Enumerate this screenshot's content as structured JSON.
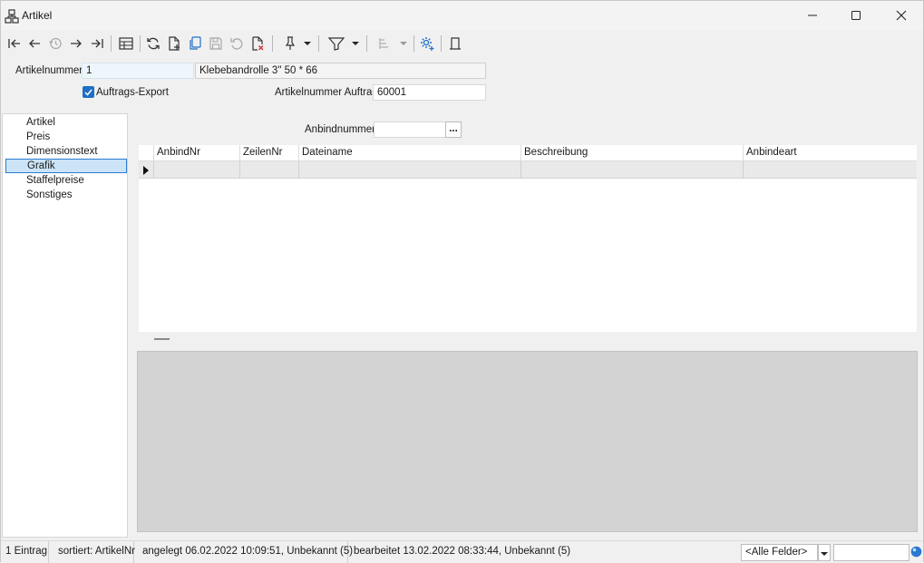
{
  "window": {
    "title": "Artikel",
    "icons": {
      "app": "window-structure-icon",
      "minimize": "minimize-icon",
      "maximize": "maximize-icon",
      "close": "close-icon"
    }
  },
  "toolbar": {
    "buttons": [
      "first-record-icon",
      "previous-record-icon",
      "history-icon",
      "next-record-icon",
      "last-record-icon",
      "table-view-icon",
      "refresh-icon",
      "new-record-icon",
      "copy-record-icon",
      "save-icon",
      "undo-icon",
      "delete-record-icon",
      "pin-icon",
      "filter-icon",
      "sort-icon",
      "settings-icon",
      "exit-door-icon"
    ]
  },
  "header": {
    "artikelnummer_label": "Artikelnummer",
    "artikelnummer_value": "1",
    "description": "Klebebandrolle 3\" 50 * 66",
    "auftrags_export_label": "Auftrags-Export",
    "auftrags_export_checked": true,
    "artikelnummer_auftrag_label": "Artikelnummer Auftrag",
    "artikelnummer_auftrag_value": "60001"
  },
  "nav": {
    "items": [
      "Artikel",
      "Preis",
      "Dimensionstext",
      "Grafik",
      "Staffelpreise",
      "Sonstiges"
    ],
    "selected": "Grafik"
  },
  "anbind": {
    "label": "Anbindnummer",
    "value": "",
    "browse_label": "..."
  },
  "grid": {
    "columns": [
      "AnbindNr",
      "ZeilenNr",
      "Dateiname",
      "Beschreibung",
      "Anbindeart"
    ],
    "rows": [
      [
        "",
        "",
        "",
        "",
        ""
      ]
    ]
  },
  "status": {
    "count": "1 Eintrag",
    "sorted": "sortiert: ArtikelNr",
    "created": "angelegt 06.02.2022 10:09:51, Unbekannt (5)",
    "edited": "bearbeitet 13.02.2022 08:33:44, Unbekannt (5)",
    "field_filter": "<Alle Felder>",
    "search_value": ""
  },
  "colors": {
    "accent": "#1f6fc5",
    "selection_bg": "#cce4f7",
    "selection_border": "#2b7bd0",
    "preview_bg": "#d3d3d3"
  }
}
